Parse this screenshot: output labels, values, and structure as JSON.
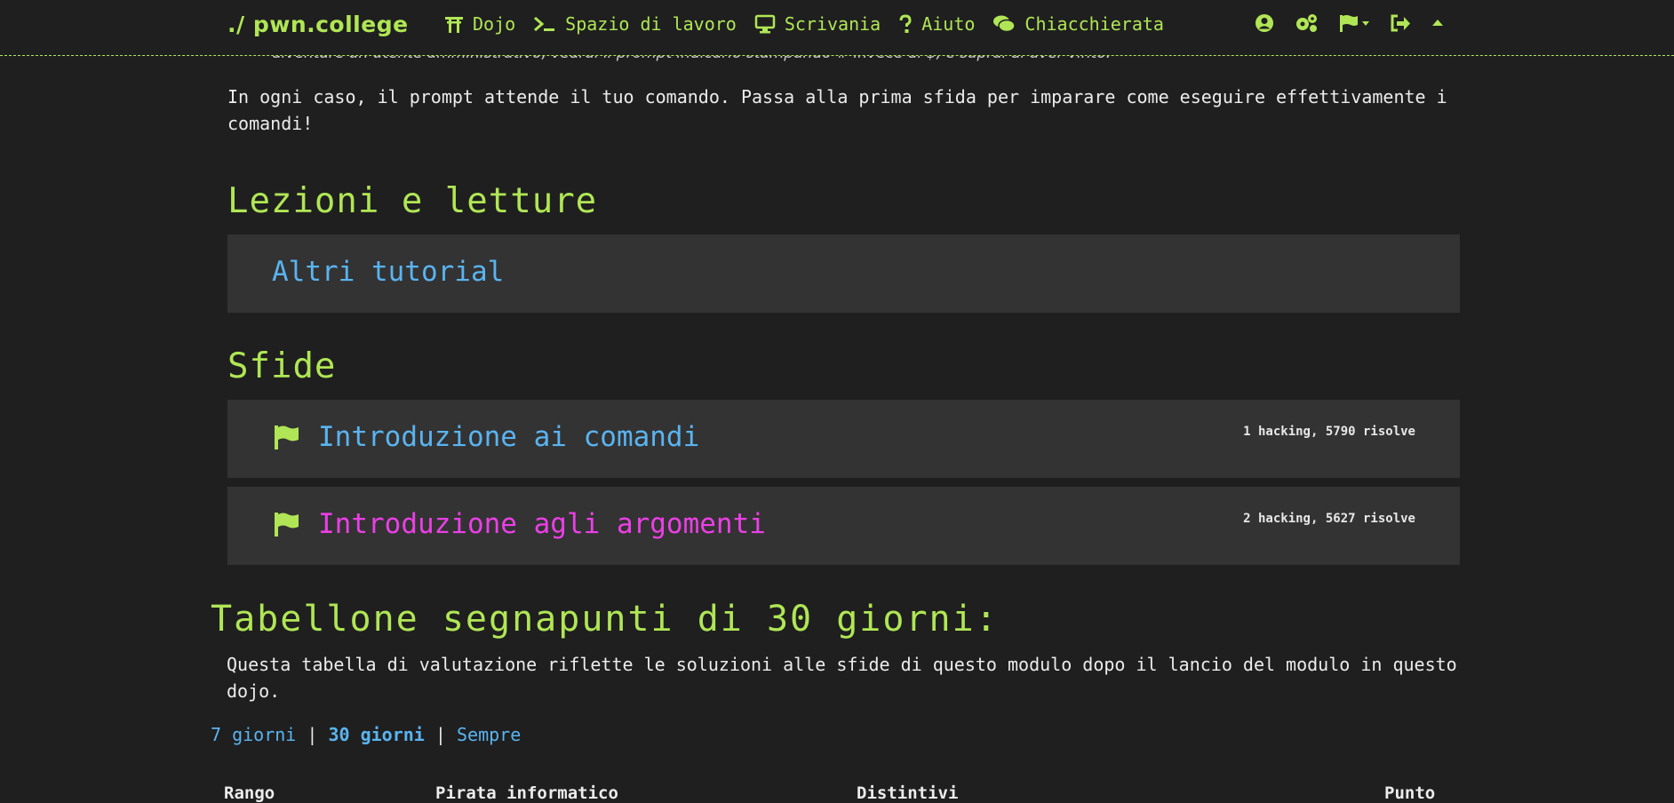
{
  "navbar": {
    "brand": "./ pwn.college",
    "items": [
      {
        "label": "Dojo",
        "icon": "torii-gate-icon"
      },
      {
        "label": "Spazio di lavoro",
        "icon": "terminal-icon"
      },
      {
        "label": "Scrivania",
        "icon": "desktop-icon"
      },
      {
        "label": "Aiuto",
        "icon": "question-icon"
      },
      {
        "label": "Chiacchierata",
        "icon": "comments-icon"
      }
    ],
    "icons": [
      "user-circle-icon",
      "settings-cogs-icon",
      "flag-dropdown-icon",
      "logout-icon",
      "chevron-up-icon"
    ]
  },
  "cut_line": "diventare un utente amministrativo, vedrai il prompt indicarlo stampando # invece di $, e saprai di aver vinto.",
  "intro_paragraph": "In ogni caso, il prompt attende il tuo comando. Passa alla prima sfida per imparare come eseguire effettivamente i comandi!",
  "lectures": {
    "heading": "Lezioni e letture",
    "items": [
      {
        "title": "Altri tutorial"
      }
    ]
  },
  "challenges": {
    "heading": "Sfide",
    "items": [
      {
        "title": "Introduzione ai comandi",
        "meta": "1 hacking, 5790 risolve",
        "icon": "flag-icon"
      },
      {
        "title": "Introduzione agli argomenti",
        "meta": "2 hacking, 5627 risolve",
        "icon": "flag-icon"
      }
    ]
  },
  "scoreboard": {
    "heading": "Tabellone segnapunti di 30 giorni:",
    "description": "Questa tabella di valutazione riflette le soluzioni alle sfide di questo modulo dopo il lancio del modulo in questo dojo.",
    "ranges": [
      "7 giorni",
      "30 giorni",
      "Sempre"
    ],
    "active_range": "30 giorni",
    "separator": "|",
    "columns": [
      "Rango",
      "Pirata informatico",
      "Distintivi",
      "Punto"
    ]
  },
  "colors": {
    "accent_green": "#b0e655",
    "link_blue": "#5ab4f0",
    "magenta": "#ec3fe6",
    "background": "#1f1f1f",
    "card": "#333333"
  }
}
